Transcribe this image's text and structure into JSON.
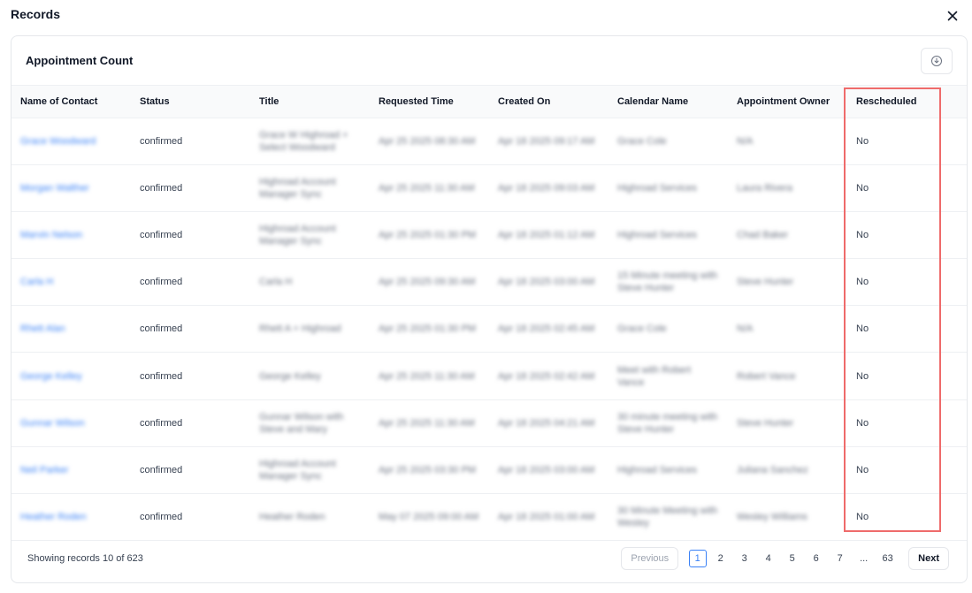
{
  "modal": {
    "title": "Records"
  },
  "card": {
    "title": "Appointment Count"
  },
  "table": {
    "columns": [
      "Name of Contact",
      "Status",
      "Title",
      "Requested Time",
      "Created On",
      "Calendar Name",
      "Appointment Owner",
      "Rescheduled"
    ],
    "rows": [
      {
        "name": "Grace Woodward",
        "status": "confirmed",
        "title": "Grace W Highroad + Select Woodward",
        "requested": "Apr 25 2025 08:30 AM",
        "created": "Apr 18 2025 09:17 AM",
        "calendar": "Grace Cole",
        "owner": "N/A",
        "rescheduled": "No"
      },
      {
        "name": "Morgan Walther",
        "status": "confirmed",
        "title": "Highroad Account Manager Sync",
        "requested": "Apr 25 2025 11:30 AM",
        "created": "Apr 18 2025 09:03 AM",
        "calendar": "Highroad Services",
        "owner": "Laura Rivera",
        "rescheduled": "No"
      },
      {
        "name": "Marvin Nelson",
        "status": "confirmed",
        "title": "Highroad Account Manager Sync",
        "requested": "Apr 25 2025 01:30 PM",
        "created": "Apr 18 2025 01:12 AM",
        "calendar": "Highroad Services",
        "owner": "Chad Baker",
        "rescheduled": "No"
      },
      {
        "name": "Carla H",
        "status": "confirmed",
        "title": "Carla H",
        "requested": "Apr 25 2025 09:30 AM",
        "created": "Apr 18 2025 03:00 AM",
        "calendar": "15 Minute meeting with Steve Hunter",
        "owner": "Steve Hunter",
        "rescheduled": "No"
      },
      {
        "name": "Rhett Alan",
        "status": "confirmed",
        "title": "Rhett A + Highroad",
        "requested": "Apr 25 2025 01:30 PM",
        "created": "Apr 18 2025 02:45 AM",
        "calendar": "Grace Cole",
        "owner": "N/A",
        "rescheduled": "No"
      },
      {
        "name": "George Kelley",
        "status": "confirmed",
        "title": "George Kelley",
        "requested": "Apr 25 2025 11:30 AM",
        "created": "Apr 18 2025 02:42 AM",
        "calendar": "Meet with Robert Vance",
        "owner": "Robert Vance",
        "rescheduled": "No"
      },
      {
        "name": "Gunnar Wilson",
        "status": "confirmed",
        "title": "Gunnar Wilson with Steve and Mary",
        "requested": "Apr 25 2025 11:30 AM",
        "created": "Apr 18 2025 04:21 AM",
        "calendar": "30 minute meeting with Steve Hunter",
        "owner": "Steve Hunter",
        "rescheduled": "No"
      },
      {
        "name": "Neil Parker",
        "status": "confirmed",
        "title": "Highroad Account Manager Sync",
        "requested": "Apr 25 2025 03:30 PM",
        "created": "Apr 18 2025 03:00 AM",
        "calendar": "Highroad Services",
        "owner": "Juliana Sanchez",
        "rescheduled": "No"
      },
      {
        "name": "Heather Roden",
        "status": "confirmed",
        "title": "Heather Roden",
        "requested": "May 07 2025 09:00 AM",
        "created": "Apr 18 2025 01:00 AM",
        "calendar": "30 Minute Meeting with Wesley",
        "owner": "Wesley Williams",
        "rescheduled": "No"
      }
    ]
  },
  "footer": {
    "showing": "Showing records 10 of 623"
  },
  "pagination": {
    "previous": "Previous",
    "next": "Next",
    "pages": [
      "1",
      "2",
      "3",
      "4",
      "5",
      "6",
      "7",
      "...",
      "63"
    ],
    "active": "1"
  },
  "colors": {
    "link": "#3b82f6",
    "highlight": "#ef6b6b",
    "active_page": "#3b82f6"
  }
}
